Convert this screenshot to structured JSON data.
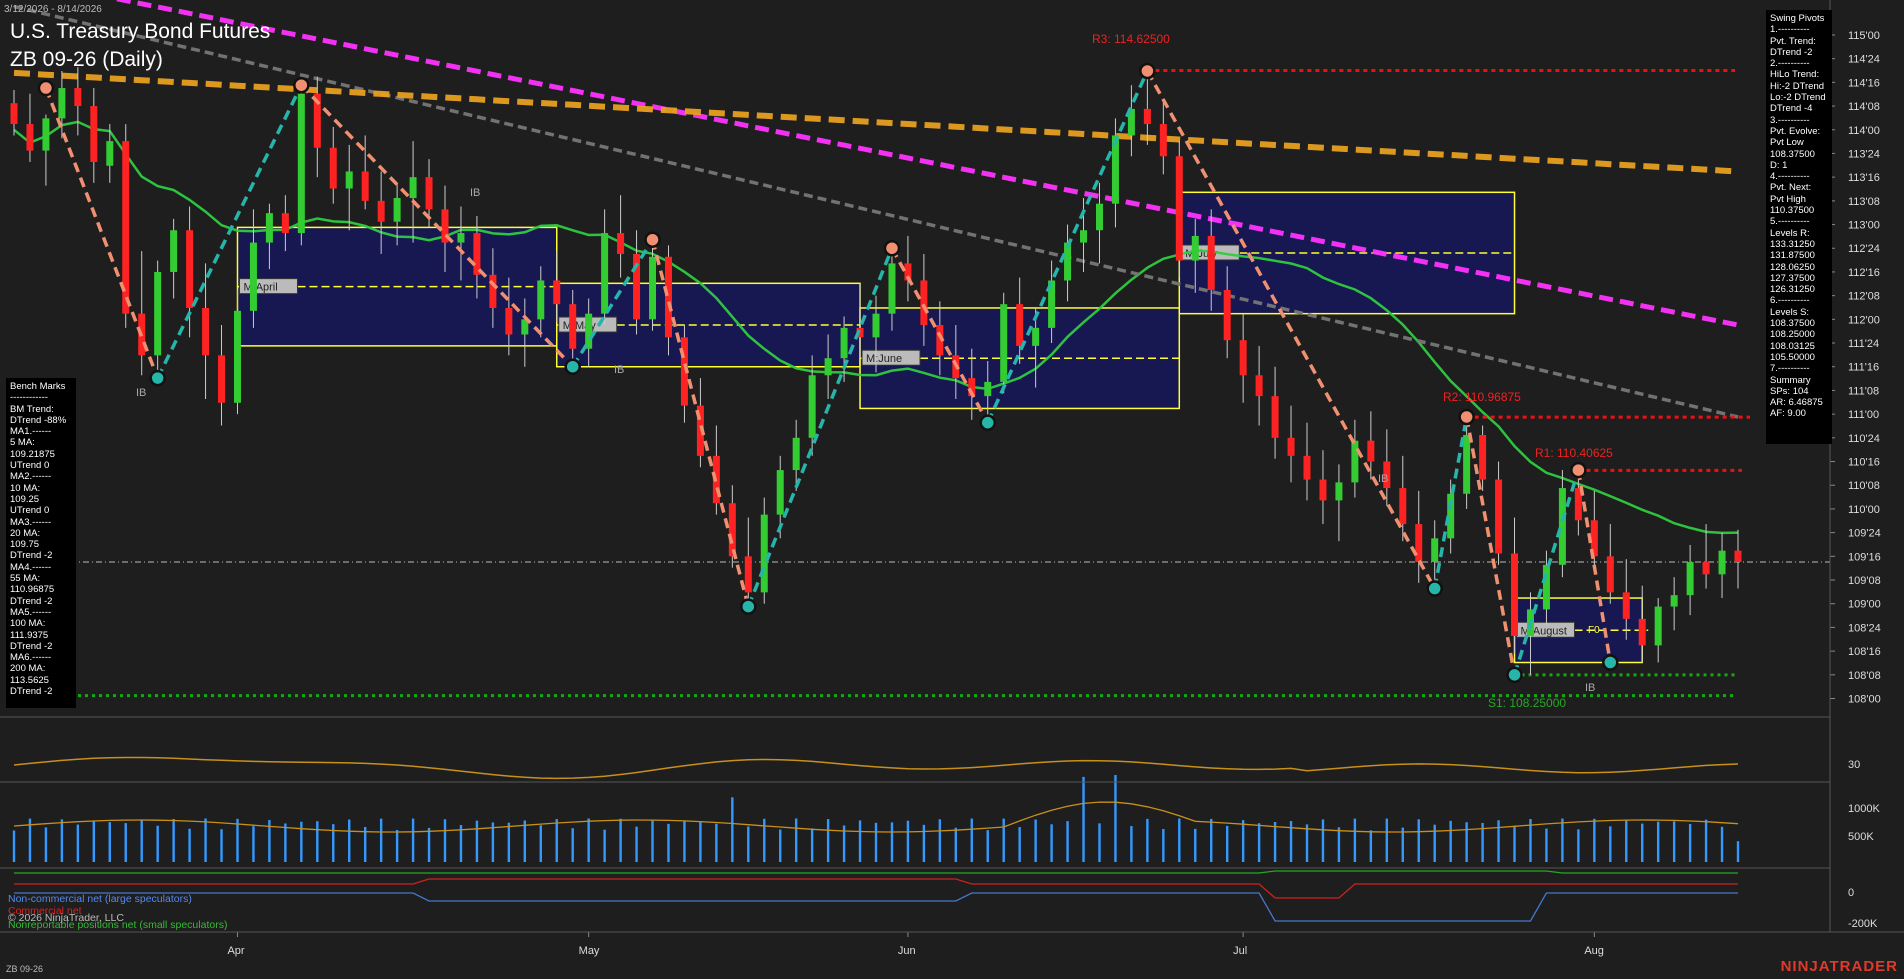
{
  "header": {
    "date_range": "3/12/2026 - 8/14/2026",
    "title": "U.S. Treasury Bond Futures",
    "subtitle": "ZB 09-26 (Daily)"
  },
  "footer": {
    "symbol": "ZB 09-26",
    "copyright": "© 2026 NinjaTrader, LLC",
    "brand": "NINJATRADER"
  },
  "bench_panel": {
    "text": "Bench Marks\n------------\nBM Trend:\nDTrend -88%\nMA1.------\n5 MA:\n109.21875\nUTrend 0\nMA2.------\n10 MA:\n109.25\nUTrend 0\nMA3.------\n20 MA:\n109.75\nDTrend -2\nMA4.------\n55 MA:\n110.96875\nDTrend -2\nMA5.------\n100 MA:\n111.9375\nDTrend -2\nMA6.------\n200 MA:\n113.5625\nDTrend -2"
  },
  "swing_panel": {
    "text": "Swing Pivots\n1.----------\nPvt. Trend:\nDTrend -2\n2.----------\nHiLo Trend:\nHi:-2 DTrend\nLo:-2 DTrend\nDTrend -4\n3.----------\nPvt. Evolve:\nPvt Low\n108.37500\nD: 1\n4.----------\nPvt. Next:\nPvt High\n110.37500\n5.----------\nLevels R:\n133.31250\n131.87500\n128.06250\n127.37500\n126.31250\n6.----------\nLevels S:\n108.37500\n108.25000\n108.03125\n105.50000\n7.----------\nSummary\nSPs: 104\nAR: 6.46875\nAF: 9.00"
  },
  "annotations": {
    "r3": "R3: 114.62500",
    "r2": "R2: 110.96875",
    "r1": "R1: 110.40625",
    "s1": "S1: 108.25000",
    "ib": "IB",
    "f0": "F0",
    "months": [
      "M:April",
      "M:May",
      "M:June",
      "M:July",
      "M:August"
    ]
  },
  "panels": {
    "cot_legend": {
      "noncommercial": "Non-commercial net (large speculators)",
      "commercial": "Commercial net",
      "nonreportable": "Nonreportable positions net (small speculators)"
    }
  },
  "colors": {
    "background": "#1e1e1e",
    "up_candle": "#33cc33",
    "down_candle": "#ff2222",
    "ma20": "#2ecc40",
    "ma55": "#777777",
    "ma100": "#ff33ff",
    "ma200": "#e8a020",
    "zigzag_up": "#26b5a9",
    "zigzag_down": "#f09070",
    "month_box": "#16165a",
    "month_border": "#ffff33",
    "resistance": "#ee1111",
    "support": "#11aa11",
    "volume": "#3399ff",
    "adx": "#c8901a",
    "noncommercial": "#4477cc",
    "commercial": "#cc2222",
    "nonreportable": "#22aa22"
  },
  "chart_data": {
    "type": "candlestick",
    "y_axis_ticks": [
      "115'00",
      "114'24",
      "114'16",
      "114'08",
      "114'00",
      "113'24",
      "113'16",
      "113'08",
      "113'00",
      "112'24",
      "112'16",
      "112'08",
      "112'00",
      "111'24",
      "111'16",
      "111'08",
      "111'00",
      "110'24",
      "110'16",
      "110'08",
      "110'00",
      "109'24",
      "109'16",
      "109'08",
      "109'00",
      "108'24",
      "108'16",
      "108'08",
      "108'00"
    ],
    "y_range": [
      107.9,
      115.2
    ],
    "x_axis_months": [
      "Apr",
      "May",
      "Jun",
      "Jul",
      "Aug"
    ],
    "x_axis_month_days": [
      14,
      36,
      56,
      77,
      99
    ],
    "days": 109,
    "candles": [
      [
        114.28,
        114.42,
        113.94,
        114.06
      ],
      [
        114.06,
        114.38,
        113.66,
        113.78
      ],
      [
        113.78,
        114.16,
        113.41,
        114.12
      ],
      [
        114.12,
        114.62,
        113.91,
        114.44
      ],
      [
        114.44,
        114.66,
        113.94,
        114.25
      ],
      [
        114.25,
        114.44,
        113.44,
        113.66
      ],
      [
        113.62,
        114.06,
        113.44,
        113.88
      ],
      [
        113.88,
        114.06,
        111.91,
        112.06
      ],
      [
        112.06,
        112.72,
        111.41,
        111.62
      ],
      [
        111.62,
        112.62,
        111.31,
        112.5
      ],
      [
        112.5,
        113.06,
        112.22,
        112.94
      ],
      [
        112.94,
        113.19,
        111.81,
        112.12
      ],
      [
        112.12,
        112.59,
        111.16,
        111.62
      ],
      [
        111.62,
        111.94,
        110.88,
        111.12
      ],
      [
        111.12,
        112.31,
        111.0,
        112.09
      ],
      [
        112.09,
        113.16,
        111.91,
        112.81
      ],
      [
        112.81,
        113.22,
        112.53,
        113.12
      ],
      [
        113.12,
        113.31,
        112.72,
        112.91
      ],
      [
        112.91,
        114.47,
        112.78,
        114.38
      ],
      [
        114.38,
        114.56,
        113.5,
        113.81
      ],
      [
        113.81,
        114.03,
        113.22,
        113.38
      ],
      [
        113.38,
        113.84,
        112.94,
        113.56
      ],
      [
        113.56,
        113.94,
        113.16,
        113.25
      ],
      [
        113.25,
        113.56,
        112.69,
        113.03
      ],
      [
        113.03,
        113.44,
        112.78,
        113.28
      ],
      [
        113.28,
        113.88,
        112.81,
        113.5
      ],
      [
        113.5,
        113.69,
        112.97,
        113.16
      ],
      [
        113.16,
        113.41,
        112.5,
        112.81
      ],
      [
        112.81,
        113.19,
        112.41,
        112.91
      ],
      [
        112.91,
        113.09,
        112.22,
        112.47
      ],
      [
        112.47,
        112.75,
        111.91,
        112.12
      ],
      [
        112.12,
        112.44,
        111.62,
        111.84
      ],
      [
        111.84,
        112.22,
        111.5,
        112.0
      ],
      [
        112.0,
        112.56,
        111.81,
        112.41
      ],
      [
        112.41,
        112.72,
        111.97,
        112.16
      ],
      [
        112.16,
        112.31,
        111.5,
        111.69
      ],
      [
        111.69,
        112.22,
        111.5,
        112.06
      ],
      [
        112.06,
        113.16,
        111.94,
        112.91
      ],
      [
        112.91,
        113.31,
        112.44,
        112.69
      ],
      [
        112.69,
        112.94,
        111.84,
        112.0
      ],
      [
        112.0,
        112.84,
        111.88,
        112.66
      ],
      [
        112.66,
        112.78,
        111.62,
        111.81
      ],
      [
        111.81,
        111.94,
        110.91,
        111.09
      ],
      [
        111.09,
        111.38,
        110.44,
        110.56
      ],
      [
        110.56,
        110.88,
        109.94,
        110.06
      ],
      [
        110.06,
        110.25,
        109.38,
        109.5
      ],
      [
        109.5,
        109.91,
        108.97,
        109.12
      ],
      [
        109.12,
        110.12,
        109.0,
        109.94
      ],
      [
        109.94,
        110.56,
        109.69,
        110.41
      ],
      [
        110.41,
        110.94,
        110.19,
        110.75
      ],
      [
        110.75,
        111.62,
        110.56,
        111.41
      ],
      [
        111.41,
        111.84,
        111.16,
        111.59
      ],
      [
        111.59,
        112.03,
        111.34,
        111.91
      ],
      [
        111.91,
        112.38,
        111.59,
        111.81
      ],
      [
        111.81,
        112.25,
        111.44,
        112.06
      ],
      [
        112.06,
        112.75,
        111.88,
        112.59
      ],
      [
        112.59,
        112.88,
        112.19,
        112.41
      ],
      [
        112.41,
        112.69,
        111.72,
        111.94
      ],
      [
        111.94,
        112.19,
        111.41,
        111.62
      ],
      [
        111.62,
        111.94,
        111.16,
        111.38
      ],
      [
        111.38,
        111.69,
        110.94,
        111.19
      ],
      [
        111.19,
        111.56,
        110.91,
        111.34
      ],
      [
        111.34,
        112.28,
        111.22,
        112.16
      ],
      [
        112.16,
        112.44,
        111.53,
        111.72
      ],
      [
        111.72,
        112.12,
        111.28,
        111.91
      ],
      [
        111.91,
        112.62,
        111.75,
        112.41
      ],
      [
        112.41,
        113.0,
        112.19,
        112.81
      ],
      [
        112.81,
        113.28,
        112.5,
        112.94
      ],
      [
        112.94,
        113.44,
        112.59,
        113.22
      ],
      [
        113.22,
        114.12,
        112.97,
        113.94
      ],
      [
        113.94,
        114.47,
        113.72,
        114.22
      ],
      [
        114.22,
        114.62,
        113.84,
        114.06
      ],
      [
        114.06,
        114.31,
        113.53,
        113.72
      ],
      [
        113.72,
        113.88,
        112.44,
        112.62
      ],
      [
        112.62,
        113.06,
        112.28,
        112.88
      ],
      [
        112.88,
        113.16,
        112.09,
        112.31
      ],
      [
        112.31,
        112.56,
        111.59,
        111.78
      ],
      [
        111.78,
        112.06,
        111.12,
        111.41
      ],
      [
        111.41,
        111.72,
        110.88,
        111.19
      ],
      [
        111.19,
        111.5,
        110.53,
        110.75
      ],
      [
        110.75,
        111.09,
        110.28,
        110.56
      ],
      [
        110.56,
        110.91,
        110.09,
        110.31
      ],
      [
        110.31,
        110.62,
        109.84,
        110.09
      ],
      [
        110.09,
        110.47,
        109.66,
        110.28
      ],
      [
        110.28,
        110.94,
        110.12,
        110.72
      ],
      [
        110.72,
        111.03,
        110.31,
        110.5
      ],
      [
        110.5,
        110.84,
        110.03,
        110.22
      ],
      [
        110.22,
        110.56,
        109.66,
        109.84
      ],
      [
        109.84,
        110.19,
        109.22,
        109.44
      ],
      [
        109.44,
        109.88,
        109.16,
        109.69
      ],
      [
        109.69,
        110.31,
        109.53,
        110.16
      ],
      [
        110.16,
        110.97,
        110.0,
        110.78
      ],
      [
        110.78,
        110.88,
        110.19,
        110.31
      ],
      [
        110.31,
        110.5,
        109.41,
        109.53
      ],
      [
        109.53,
        109.91,
        108.47,
        108.66
      ],
      [
        108.66,
        109.12,
        108.25,
        108.94
      ],
      [
        108.94,
        109.56,
        108.78,
        109.41
      ],
      [
        109.41,
        110.41,
        109.28,
        110.22
      ],
      [
        110.22,
        110.41,
        109.72,
        109.88
      ],
      [
        109.88,
        110.19,
        109.34,
        109.5
      ],
      [
        109.5,
        109.84,
        109.0,
        109.12
      ],
      [
        109.12,
        109.47,
        108.62,
        108.84
      ],
      [
        108.84,
        109.19,
        108.38,
        108.56
      ],
      [
        108.56,
        109.06,
        108.38,
        108.97
      ],
      [
        108.97,
        109.28,
        108.72,
        109.09
      ],
      [
        109.09,
        109.62,
        108.88,
        109.44
      ],
      [
        109.44,
        109.84,
        109.16,
        109.31
      ],
      [
        109.31,
        109.75,
        109.06,
        109.56
      ],
      [
        109.56,
        109.78,
        109.16,
        109.44
      ]
    ],
    "moving_averages": [
      {
        "name": "20 MA",
        "start": 114.0,
        "end": 109.75
      },
      {
        "name": "55 MA",
        "start": 115.3,
        "end": 110.97
      },
      {
        "name": "100 MA",
        "start": 115.6,
        "end": 111.94
      },
      {
        "name": "200 MA",
        "start": 114.6,
        "end": 113.56
      }
    ],
    "swing_pivots": [
      {
        "day": 2,
        "price": 114.44,
        "type": "high"
      },
      {
        "day": 9,
        "price": 111.38,
        "type": "low"
      },
      {
        "day": 18,
        "price": 114.47,
        "type": "high"
      },
      {
        "day": 35,
        "price": 111.5,
        "type": "low"
      },
      {
        "day": 40,
        "price": 112.84,
        "type": "high"
      },
      {
        "day": 46,
        "price": 108.97,
        "type": "low"
      },
      {
        "day": 55,
        "price": 112.75,
        "type": "high"
      },
      {
        "day": 61,
        "price": 110.91,
        "type": "low"
      },
      {
        "day": 71,
        "price": 114.62,
        "type": "high"
      },
      {
        "day": 89,
        "price": 109.16,
        "type": "low"
      },
      {
        "day": 91,
        "price": 110.97,
        "type": "high"
      },
      {
        "day": 94,
        "price": 108.25,
        "type": "low"
      },
      {
        "day": 98,
        "price": 110.41,
        "type": "high"
      },
      {
        "day": 100,
        "price": 108.38,
        "type": "low"
      }
    ],
    "levels": {
      "r3": 114.625,
      "r2": 110.96875,
      "r1": 110.40625,
      "s1": 108.25,
      "last": 109.44
    },
    "month_boxes": [
      {
        "label": "M:April",
        "from": 14,
        "to": 34,
        "high": 112.97,
        "low": 111.72
      },
      {
        "label": "M:May",
        "from": 34,
        "to": 53,
        "high": 112.38,
        "low": 111.5
      },
      {
        "label": "M:June",
        "from": 53,
        "to": 73,
        "high": 112.12,
        "low": 111.06
      },
      {
        "label": "M:July",
        "from": 73,
        "to": 94,
        "high": 113.34,
        "low": 112.06
      },
      {
        "label": "M:August",
        "from": 94,
        "to": 102,
        "high": 109.06,
        "low": 108.38
      }
    ],
    "adx_label": "30",
    "volume_ticks": [
      "1000K",
      "500K"
    ],
    "cot_ticks": [
      "0",
      "-200K"
    ]
  }
}
